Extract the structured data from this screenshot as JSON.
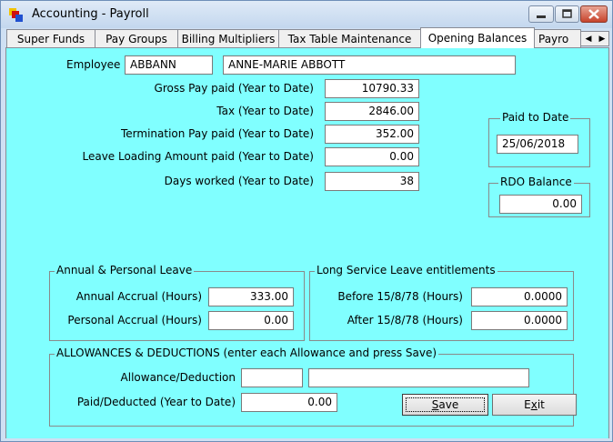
{
  "window": {
    "title": "Accounting - Payroll"
  },
  "tabs": [
    {
      "label": "Super Funds"
    },
    {
      "label": "Pay Groups"
    },
    {
      "label": "Billing Multipliers"
    },
    {
      "label": "Tax Table Maintenance"
    },
    {
      "label": "Opening Balances",
      "active": true
    },
    {
      "label": "Payro"
    }
  ],
  "employee": {
    "label": "Employee",
    "code": "ABBANN",
    "name": "ANNE-MARIE ABBOTT"
  },
  "balances": [
    {
      "label": "Gross Pay paid (Year to Date)",
      "value": "10790.33"
    },
    {
      "label": "Tax (Year to Date)",
      "value": "2846.00"
    },
    {
      "label": "Termination Pay paid (Year to Date)",
      "value": "352.00"
    },
    {
      "label": "Leave Loading Amount paid (Year to Date)",
      "value": "0.00"
    },
    {
      "label": "Days worked (Year to Date)",
      "value": "38"
    }
  ],
  "paid_to_date": {
    "label": "Paid to Date",
    "value": "25/06/2018"
  },
  "rdo_balance": {
    "label": "RDO Balance",
    "value": "0.00"
  },
  "annual_leave": {
    "label": "Annual & Personal Leave",
    "annual_label": "Annual Accrual (Hours)",
    "annual_value": "333.00",
    "personal_label": "Personal Accrual (Hours)",
    "personal_value": "0.00"
  },
  "long_service": {
    "label": "Long Service Leave entitlements",
    "before_label": "Before 15/8/78 (Hours)",
    "before_value": "0.0000",
    "after_label": "After 15/8/78 (Hours)",
    "after_value": "0.0000"
  },
  "allowances": {
    "label": "ALLOWANCES & DEDUCTIONS (enter each Allowance and press Save)",
    "allowance_label": "Allowance/Deduction",
    "allowance_code": "",
    "allowance_desc": "",
    "paid_label": "Paid/Deducted (Year to Date)",
    "paid_value": "0.00"
  },
  "buttons": {
    "save_rest": "ave",
    "save_key": "S",
    "exit_pre": "E",
    "exit_key": "x",
    "exit_rest": "it"
  },
  "colors": {
    "panel": "#80ffff",
    "titlebar": "#c3d7ee"
  }
}
